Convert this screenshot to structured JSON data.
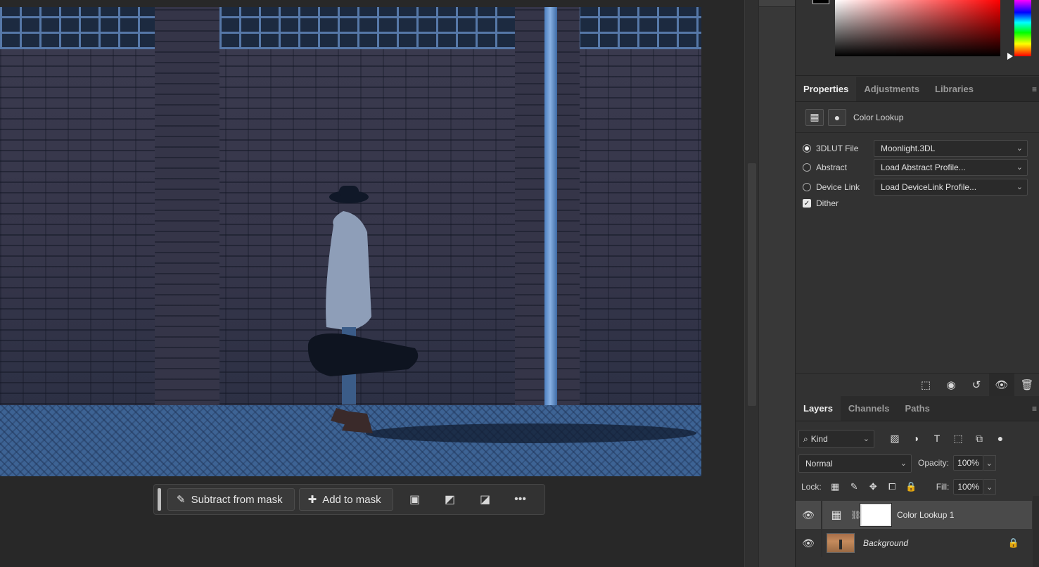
{
  "taskbar": {
    "subtract_label": "Subtract from mask",
    "add_label": "Add to mask",
    "icons": [
      "mask-options-icon",
      "invert-mask-icon",
      "mask-visibility-icon",
      "more-icon"
    ]
  },
  "properties_tabs": [
    "Properties",
    "Adjustments",
    "Libraries"
  ],
  "properties": {
    "title": "Color Lookup",
    "rows": [
      {
        "label": "3DLUT File",
        "value": "Moonlight.3DL",
        "selected": true
      },
      {
        "label": "Abstract",
        "value": "Load Abstract Profile...",
        "selected": false
      },
      {
        "label": "Device Link",
        "value": "Load DeviceLink Profile...",
        "selected": false
      }
    ],
    "dither_label": "Dither",
    "dither_checked": true
  },
  "layers_tabs": [
    "Layers",
    "Channels",
    "Paths"
  ],
  "layers": {
    "filter_label": "Kind",
    "blend_mode": "Normal",
    "opacity_label": "Opacity:",
    "opacity_value": "100%",
    "lock_label": "Lock:",
    "fill_label": "Fill:",
    "fill_value": "100%",
    "items": [
      {
        "name": "Color Lookup 1",
        "selected": true
      },
      {
        "name": "Background",
        "selected": false,
        "locked": true
      }
    ]
  },
  "colors": {
    "accent_picker": "#ff0000",
    "panel_bg": "#323232",
    "canvas_bg": "#282828"
  }
}
